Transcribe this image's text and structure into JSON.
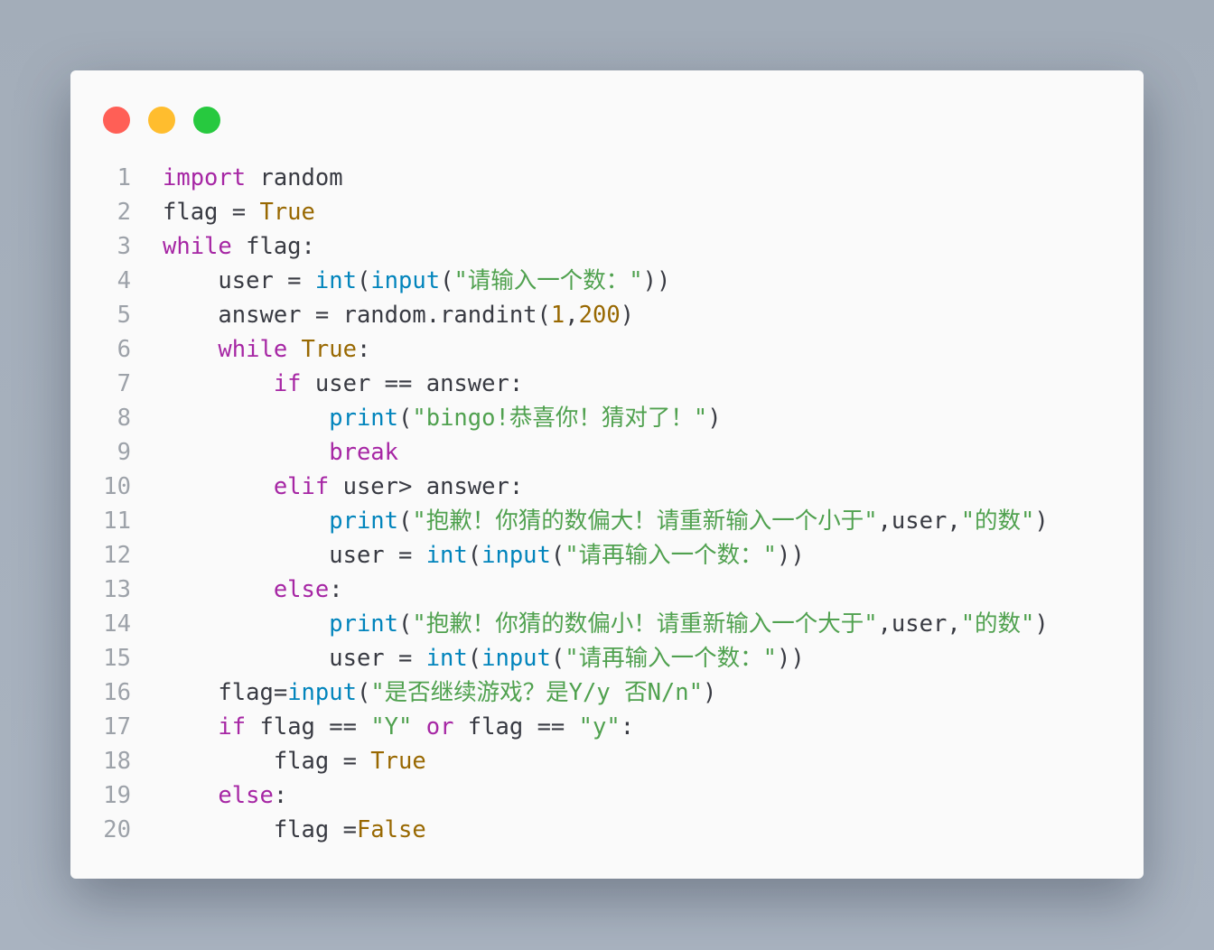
{
  "window": {
    "traffic_lights": [
      {
        "name": "close",
        "color": "#ff5f56"
      },
      {
        "name": "minimize",
        "color": "#ffbd2e"
      },
      {
        "name": "zoom",
        "color": "#27c93f"
      }
    ]
  },
  "editor": {
    "language": "python",
    "colors": {
      "keyword": "#a626a4",
      "builtin": "#0184bc",
      "string": "#50a14f",
      "number": "#986801",
      "text": "#383a42",
      "line_number": "#9da2a9"
    },
    "lines": [
      {
        "number": "1",
        "indent": "",
        "tokens": [
          [
            "kw",
            "import"
          ],
          [
            "txt",
            " random"
          ]
        ]
      },
      {
        "number": "2",
        "indent": "",
        "tokens": [
          [
            "txt",
            "flag = "
          ],
          [
            "num",
            "True"
          ]
        ]
      },
      {
        "number": "3",
        "indent": "",
        "tokens": [
          [
            "kw",
            "while"
          ],
          [
            "txt",
            " flag:"
          ]
        ]
      },
      {
        "number": "4",
        "indent": "    ",
        "tokens": [
          [
            "txt",
            "user = "
          ],
          [
            "fn",
            "int"
          ],
          [
            "txt",
            "("
          ],
          [
            "fn",
            "input"
          ],
          [
            "txt",
            "("
          ],
          [
            "str",
            "\"请输入一个数：\""
          ],
          [
            "txt",
            "))"
          ]
        ]
      },
      {
        "number": "5",
        "indent": "    ",
        "tokens": [
          [
            "txt",
            "answer = random.randint("
          ],
          [
            "num",
            "1"
          ],
          [
            "txt",
            ","
          ],
          [
            "num",
            "200"
          ],
          [
            "txt",
            ")"
          ]
        ]
      },
      {
        "number": "6",
        "indent": "    ",
        "tokens": [
          [
            "kw",
            "while"
          ],
          [
            "txt",
            " "
          ],
          [
            "num",
            "True"
          ],
          [
            "txt",
            ":"
          ]
        ]
      },
      {
        "number": "7",
        "indent": "        ",
        "tokens": [
          [
            "kw",
            "if"
          ],
          [
            "txt",
            " user == answer:"
          ]
        ]
      },
      {
        "number": "8",
        "indent": "            ",
        "tokens": [
          [
            "fn",
            "print"
          ],
          [
            "txt",
            "("
          ],
          [
            "str",
            "\"bingo!恭喜你！猜对了！\""
          ],
          [
            "txt",
            ")"
          ]
        ]
      },
      {
        "number": "9",
        "indent": "            ",
        "tokens": [
          [
            "kw",
            "break"
          ]
        ]
      },
      {
        "number": "10",
        "indent": "        ",
        "tokens": [
          [
            "kw",
            "elif"
          ],
          [
            "txt",
            " user> answer:"
          ]
        ]
      },
      {
        "number": "11",
        "indent": "            ",
        "tokens": [
          [
            "fn",
            "print"
          ],
          [
            "txt",
            "("
          ],
          [
            "str",
            "\"抱歉！你猜的数偏大！请重新输入一个小于\""
          ],
          [
            "txt",
            ",user,"
          ],
          [
            "str",
            "\"的数\""
          ],
          [
            "txt",
            ")"
          ]
        ]
      },
      {
        "number": "12",
        "indent": "            ",
        "tokens": [
          [
            "txt",
            "user = "
          ],
          [
            "fn",
            "int"
          ],
          [
            "txt",
            "("
          ],
          [
            "fn",
            "input"
          ],
          [
            "txt",
            "("
          ],
          [
            "str",
            "\"请再输入一个数：\""
          ],
          [
            "txt",
            "))"
          ]
        ]
      },
      {
        "number": "13",
        "indent": "        ",
        "tokens": [
          [
            "kw",
            "else"
          ],
          [
            "txt",
            ":"
          ]
        ]
      },
      {
        "number": "14",
        "indent": "            ",
        "tokens": [
          [
            "fn",
            "print"
          ],
          [
            "txt",
            "("
          ],
          [
            "str",
            "\"抱歉！你猜的数偏小！请重新输入一个大于\""
          ],
          [
            "txt",
            ",user,"
          ],
          [
            "str",
            "\"的数\""
          ],
          [
            "txt",
            ")"
          ]
        ]
      },
      {
        "number": "15",
        "indent": "            ",
        "tokens": [
          [
            "txt",
            "user = "
          ],
          [
            "fn",
            "int"
          ],
          [
            "txt",
            "("
          ],
          [
            "fn",
            "input"
          ],
          [
            "txt",
            "("
          ],
          [
            "str",
            "\"请再输入一个数：\""
          ],
          [
            "txt",
            "))"
          ]
        ]
      },
      {
        "number": "16",
        "indent": "    ",
        "tokens": [
          [
            "txt",
            "flag="
          ],
          [
            "fn",
            "input"
          ],
          [
            "txt",
            "("
          ],
          [
            "str",
            "\"是否继续游戏？是Y/y 否N/n\""
          ],
          [
            "txt",
            ")"
          ]
        ]
      },
      {
        "number": "17",
        "indent": "    ",
        "tokens": [
          [
            "kw",
            "if"
          ],
          [
            "txt",
            " flag == "
          ],
          [
            "str",
            "\"Y\""
          ],
          [
            "txt",
            " "
          ],
          [
            "kw",
            "or"
          ],
          [
            "txt",
            " flag == "
          ],
          [
            "str",
            "\"y\""
          ],
          [
            "txt",
            ":"
          ]
        ]
      },
      {
        "number": "18",
        "indent": "        ",
        "tokens": [
          [
            "txt",
            "flag = "
          ],
          [
            "num",
            "True"
          ]
        ]
      },
      {
        "number": "19",
        "indent": "    ",
        "tokens": [
          [
            "kw",
            "else"
          ],
          [
            "txt",
            ":"
          ]
        ]
      },
      {
        "number": "20",
        "indent": "        ",
        "tokens": [
          [
            "txt",
            "flag ="
          ],
          [
            "num",
            "False"
          ]
        ]
      }
    ]
  }
}
